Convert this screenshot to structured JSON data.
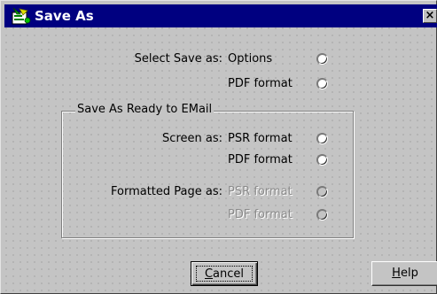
{
  "window": {
    "title": "Save As",
    "close_glyph": "×",
    "icon": "app-icon"
  },
  "save_section": {
    "label": "Select Save  as:",
    "options": [
      {
        "label": "Options",
        "selected": false,
        "enabled": true
      },
      {
        "label": "PDF format",
        "selected": false,
        "enabled": true
      }
    ]
  },
  "email_group": {
    "title": "Save As Ready to EMail",
    "screen": {
      "label": "Screen as:",
      "options": [
        {
          "label": "PSR format",
          "selected": false,
          "enabled": true
        },
        {
          "label": "PDF format",
          "selected": false,
          "enabled": true
        }
      ]
    },
    "formatted_page": {
      "label": "Formatted Page as:",
      "options": [
        {
          "label": "PSR format",
          "selected": false,
          "enabled": false
        },
        {
          "label": "PDF format",
          "selected": false,
          "enabled": false
        }
      ]
    }
  },
  "buttons": {
    "cancel": "Cancel",
    "help": "Help"
  },
  "colors": {
    "titlebar": "#000080",
    "dialog_bg": "#c4c4c4",
    "disabled_text": "#8a8a8a"
  }
}
